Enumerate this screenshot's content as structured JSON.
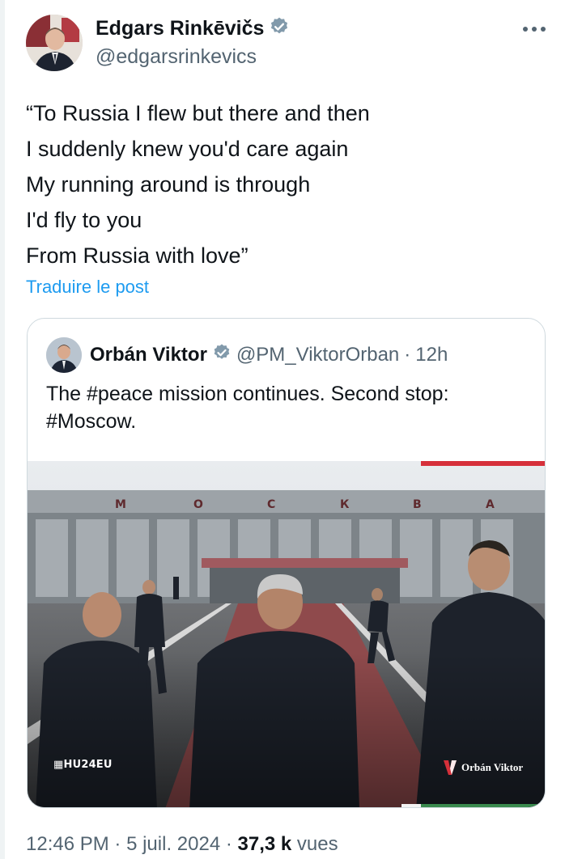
{
  "author": {
    "display_name": "Edgars Rinkēvičs",
    "handle": "@edgarsrinkevics",
    "verified": true
  },
  "more_icon": "ellipsis-icon",
  "tweet_lines": [
    "“To Russia I flew but there and then",
    "I suddenly knew you'd care again",
    "My running around is through",
    "I'd fly to you",
    "From Russia with love”"
  ],
  "translate_label": "Traduire le post",
  "quote": {
    "display_name": "Orbán Viktor",
    "handle": "@PM_ViktorOrban",
    "separator": "·",
    "time_ago": "12h",
    "text_line_1": "The #peace mission continues. Second stop:",
    "text_line_2": "#Moscow.",
    "media": {
      "building_sign_letters": [
        "М",
        "О",
        "С",
        "К",
        "В",
        "А"
      ],
      "watermark_left": "HU24EU",
      "watermark_right": "Orbán Viktor"
    }
  },
  "meta": {
    "time": "12:46 PM",
    "sep1": "·",
    "date": "5 juil. 2024",
    "sep2": "·",
    "views_count": "37,3 k",
    "views_label": "vues"
  },
  "colors": {
    "link_blue": "#1d9bf0",
    "verified_blue": "#829aab",
    "text": "#0f1419",
    "muted": "#536471"
  }
}
